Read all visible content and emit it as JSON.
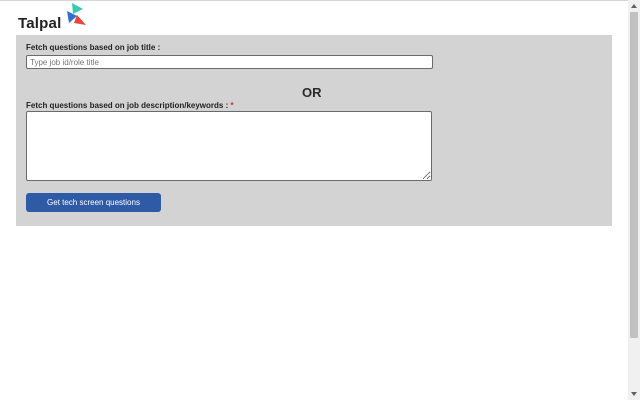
{
  "logo": {
    "text": "Talpal"
  },
  "form": {
    "job_title_label": "Fetch questions based on job title :",
    "job_title_placeholder": "Type job id/role title",
    "job_title_value": "",
    "or_text": "OR",
    "description_label": "Fetch questions based on job description/keywords :",
    "required_mark": "*",
    "description_value": "",
    "submit_label": "Get tech screen questions"
  },
  "colors": {
    "panel_bg": "#d3d3d3",
    "button_bg": "#2e5aa6",
    "required": "#d32f2f",
    "logo_teal": "#3cc9b4",
    "logo_red": "#e8453c",
    "logo_blue": "#2f6fd1"
  },
  "icons": {
    "logo_mark": "triangles-logo-icon",
    "scroll_up": "chevron-up-icon",
    "scroll_down": "chevron-down-icon"
  }
}
